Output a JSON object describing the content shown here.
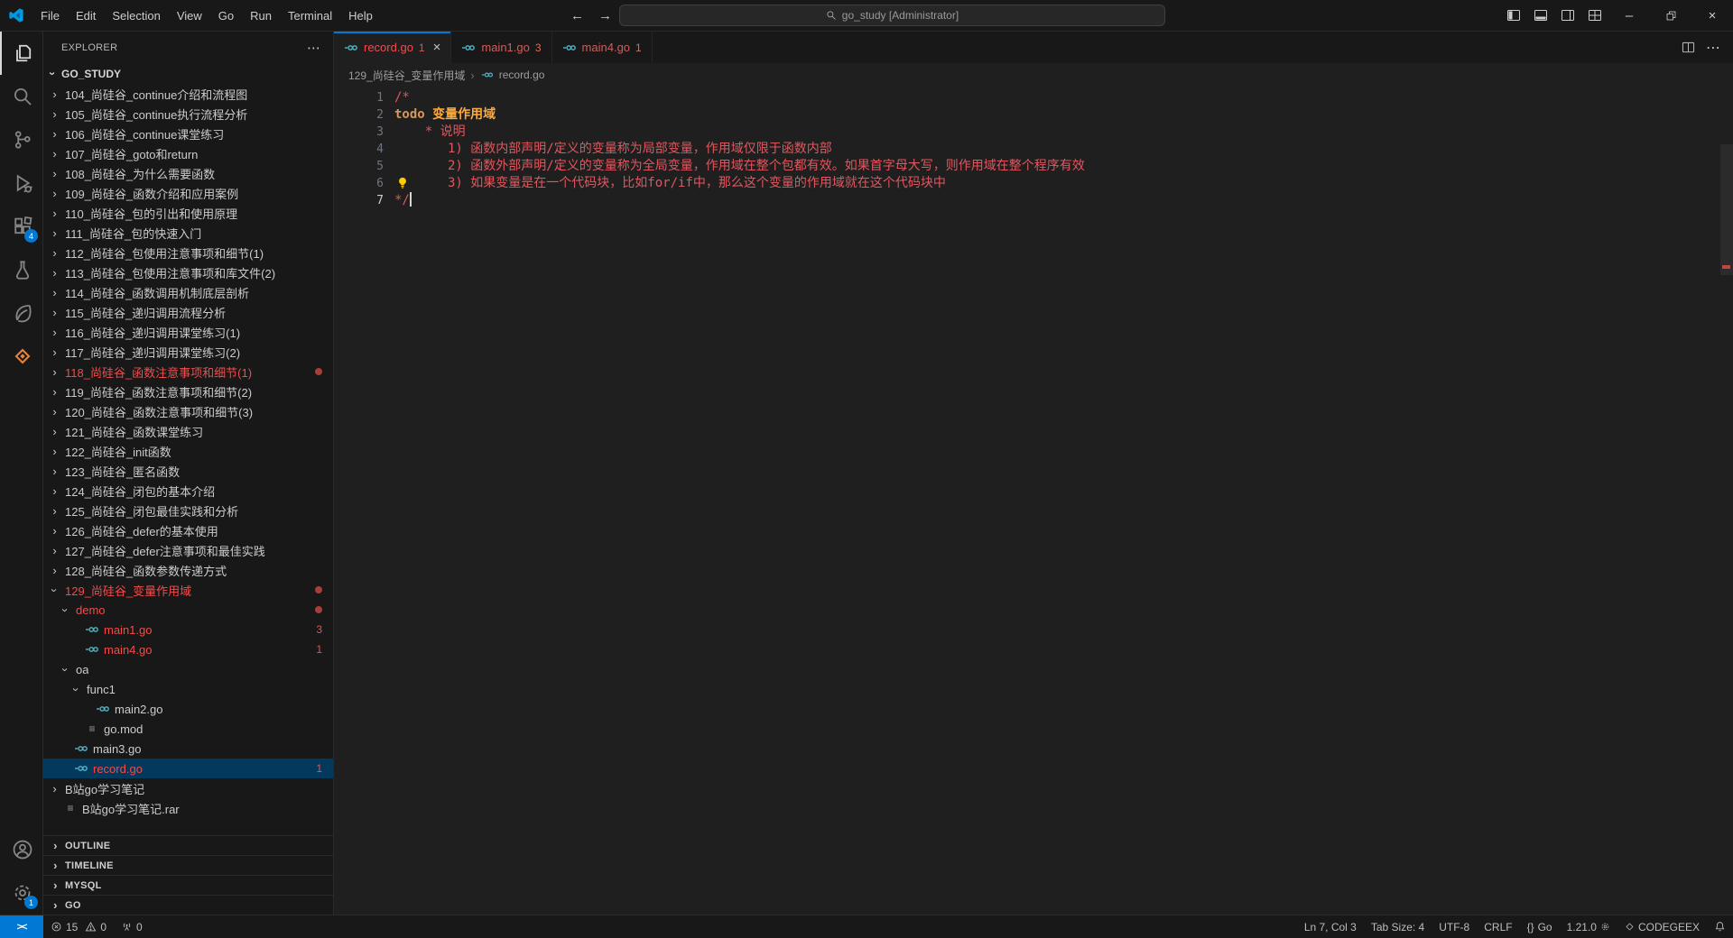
{
  "titlebar": {
    "menu": [
      "File",
      "Edit",
      "Selection",
      "View",
      "Go",
      "Run",
      "Terminal",
      "Help"
    ],
    "command_center": "go_study [Administrator]",
    "back_arrow": "←",
    "forward_arrow": "→",
    "minimize": "–",
    "close": "×"
  },
  "activitybar": {
    "extensions_badge": "4",
    "settings_badge": "1"
  },
  "sidebar": {
    "title": "EXPLORER",
    "more": "⋯",
    "root": "GO_STUDY",
    "tree": [
      {
        "label": "104_尚硅谷_continue介绍和流程图",
        "kind": "folder",
        "level": 1
      },
      {
        "label": "105_尚硅谷_continue执行流程分析",
        "kind": "folder",
        "level": 1
      },
      {
        "label": "106_尚硅谷_continue课堂练习",
        "kind": "folder",
        "level": 1
      },
      {
        "label": "107_尚硅谷_goto和return",
        "kind": "folder",
        "level": 1
      },
      {
        "label": "108_尚硅谷_为什么需要函数",
        "kind": "folder",
        "level": 1
      },
      {
        "label": "109_尚硅谷_函数介绍和应用案例",
        "kind": "folder",
        "level": 1
      },
      {
        "label": "110_尚硅谷_包的引出和使用原理",
        "kind": "folder",
        "level": 1
      },
      {
        "label": "111_尚硅谷_包的快速入门",
        "kind": "folder",
        "level": 1
      },
      {
        "label": "112_尚硅谷_包使用注意事项和细节(1)",
        "kind": "folder",
        "level": 1
      },
      {
        "label": "113_尚硅谷_包使用注意事项和库文件(2)",
        "kind": "folder",
        "level": 1
      },
      {
        "label": "114_尚硅谷_函数调用机制底层剖析",
        "kind": "folder",
        "level": 1
      },
      {
        "label": "115_尚硅谷_递归调用流程分析",
        "kind": "folder",
        "level": 1
      },
      {
        "label": "116_尚硅谷_递归调用课堂练习(1)",
        "kind": "folder",
        "level": 1
      },
      {
        "label": "117_尚硅谷_递归调用课堂练习(2)",
        "kind": "folder",
        "level": 1
      },
      {
        "label": "118_尚硅谷_函数注意事项和细节(1)",
        "kind": "folder",
        "level": 1,
        "error": true,
        "dot": true
      },
      {
        "label": "119_尚硅谷_函数注意事项和细节(2)",
        "kind": "folder",
        "level": 1
      },
      {
        "label": "120_尚硅谷_函数注意事项和细节(3)",
        "kind": "folder",
        "level": 1
      },
      {
        "label": "121_尚硅谷_函数课堂练习",
        "kind": "folder",
        "level": 1
      },
      {
        "label": "122_尚硅谷_init函数",
        "kind": "folder",
        "level": 1
      },
      {
        "label": "123_尚硅谷_匿名函数",
        "kind": "folder",
        "level": 1
      },
      {
        "label": "124_尚硅谷_闭包的基本介绍",
        "kind": "folder",
        "level": 1
      },
      {
        "label": "125_尚硅谷_闭包最佳实践和分析",
        "kind": "folder",
        "level": 1
      },
      {
        "label": "126_尚硅谷_defer的基本使用",
        "kind": "folder",
        "level": 1
      },
      {
        "label": "127_尚硅谷_defer注意事项和最佳实践",
        "kind": "folder",
        "level": 1
      },
      {
        "label": "128_尚硅谷_函数参数传递方式",
        "kind": "folder",
        "level": 1
      },
      {
        "label": "129_尚硅谷_变量作用域",
        "kind": "folder",
        "level": 1,
        "open": true,
        "error": true,
        "dot": true
      },
      {
        "label": "demo",
        "kind": "folder",
        "level": 2,
        "open": true,
        "error": true,
        "dot": true
      },
      {
        "label": "main1.go",
        "kind": "file",
        "icon": "go",
        "level": 3,
        "error": true,
        "badge": "3"
      },
      {
        "label": "main4.go",
        "kind": "file",
        "icon": "go",
        "level": 3,
        "error": true,
        "badge": "1"
      },
      {
        "label": "oa",
        "kind": "folder",
        "level": 2,
        "open": true
      },
      {
        "label": "func1",
        "kind": "folder",
        "level": 3,
        "open": true
      },
      {
        "label": "main2.go",
        "kind": "file",
        "icon": "go",
        "level": 4
      },
      {
        "label": "go.mod",
        "kind": "file",
        "icon": "mod",
        "level": 3
      },
      {
        "label": "main3.go",
        "kind": "file",
        "icon": "go",
        "level": 2
      },
      {
        "label": "record.go",
        "kind": "file",
        "icon": "go",
        "level": 2,
        "error": true,
        "badge": "1",
        "selected": true
      },
      {
        "label": "B站go学习笔记",
        "kind": "folder",
        "level": 1
      },
      {
        "label": "B站go学习笔记.rar",
        "kind": "file",
        "icon": "archive",
        "level": 1
      }
    ],
    "panels": [
      "OUTLINE",
      "TIMELINE",
      "MYSQL",
      "GO"
    ]
  },
  "editor": {
    "tabs": [
      {
        "label": "record.go",
        "badge": "1",
        "active": true
      },
      {
        "label": "main1.go",
        "badge": "3"
      },
      {
        "label": "main4.go",
        "badge": "1"
      }
    ],
    "tab_actions_more": "⋯",
    "breadcrumb": {
      "folder": "129_尚硅谷_变量作用域",
      "sep": "›",
      "file": "record.go"
    },
    "lines": [
      {
        "n": "1",
        "segs": [
          {
            "t": "/*",
            "c": "cmt"
          }
        ]
      },
      {
        "n": "2",
        "segs": [
          {
            "t": "todo",
            "c": "todo"
          },
          {
            "t": " ",
            "c": "cmt"
          },
          {
            "t": "变量作用域",
            "c": "todo-title"
          }
        ]
      },
      {
        "n": "3",
        "segs": [
          {
            "t": "    * 说明",
            "c": "cmt"
          }
        ]
      },
      {
        "n": "4",
        "segs": [
          {
            "t": "       1) 函数内部声明/定义的变量称为局部变量，作用域仅限于函数内部",
            "c": "cmt"
          }
        ]
      },
      {
        "n": "5",
        "segs": [
          {
            "t": "       2) 函数外部声明/定义的变量称为全局变量，作用域在整个包都有效。如果首字母大写，则作用域在整个程序有效",
            "c": "cmt"
          }
        ]
      },
      {
        "n": "6",
        "segs": [
          {
            "t": "       3) 如果变量是在一个代码块，比如for/if中，那么这个变量的作用域就在这个代码块中",
            "c": "cmt"
          }
        ],
        "lightbulb": true
      },
      {
        "n": "7",
        "segs": [
          {
            "t": "*/",
            "c": "cmt"
          }
        ],
        "cursor": true,
        "active": true
      }
    ]
  },
  "statusbar": {
    "remote": "><",
    "errors": "15",
    "warnings": "0",
    "ports": "0",
    "line_col": "Ln 7, Col 3",
    "tab_size": "Tab Size: 4",
    "encoding": "UTF-8",
    "eol": "CRLF",
    "language_prefix": "{}",
    "language": "Go",
    "go_version": "1.21.0",
    "codegeex": "CODEGEEX"
  },
  "colors": {
    "accent_blue": "#0078d4",
    "error_red": "#f14c4c",
    "comment_red": "#e0575f",
    "todo_orange": "#ffaa3c",
    "go_icon_cyan": "#4fb8c9",
    "editor_bg": "#1f1f1f",
    "chrome_bg": "#181818",
    "selection_bg": "#04395e"
  }
}
